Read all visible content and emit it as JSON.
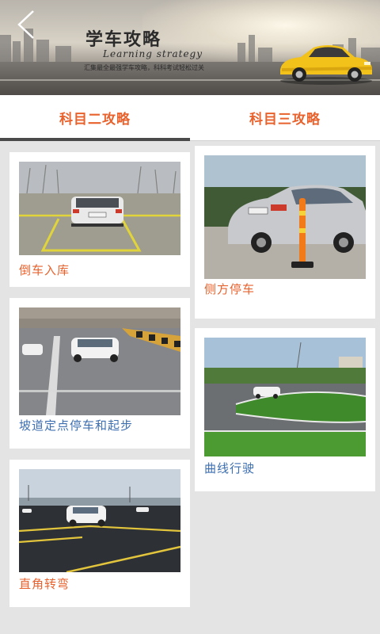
{
  "header": {
    "title": "学车攻略",
    "subtitle": "Learning strategy",
    "description": "汇集最全最强学车攻略，科科考试轻松过关"
  },
  "tabs": [
    {
      "label": "科目二攻略",
      "active": true
    },
    {
      "label": "科目三攻略",
      "active": false
    }
  ],
  "left_cards": [
    {
      "label": "倒车入库",
      "label_color": "#e8622d"
    },
    {
      "label": "坡道定点停车和起步",
      "label_color": "#3d6fb0"
    },
    {
      "label": "直角转弯",
      "label_color": "#e8622d"
    }
  ],
  "right_cards": [
    {
      "label": "侧方停车",
      "label_color": "#e8622d"
    },
    {
      "label": "曲线行驶",
      "label_color": "#3d6fb0"
    }
  ],
  "colors": {
    "accent": "#e8622d",
    "link_blue": "#3d6fb0",
    "tab_indicator": "#4a4a4a",
    "background": "#e4e4e4"
  }
}
